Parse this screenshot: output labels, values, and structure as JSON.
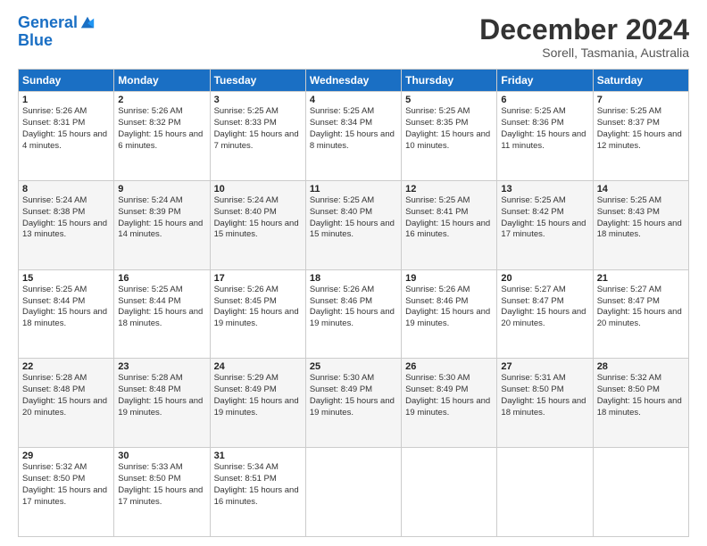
{
  "header": {
    "logo_line1": "General",
    "logo_line2": "Blue",
    "month_title": "December 2024",
    "location": "Sorell, Tasmania, Australia"
  },
  "weekdays": [
    "Sunday",
    "Monday",
    "Tuesday",
    "Wednesday",
    "Thursday",
    "Friday",
    "Saturday"
  ],
  "weeks": [
    [
      {
        "day": "1",
        "sunrise": "Sunrise: 5:26 AM",
        "sunset": "Sunset: 8:31 PM",
        "daylight": "Daylight: 15 hours and 4 minutes."
      },
      {
        "day": "2",
        "sunrise": "Sunrise: 5:26 AM",
        "sunset": "Sunset: 8:32 PM",
        "daylight": "Daylight: 15 hours and 6 minutes."
      },
      {
        "day": "3",
        "sunrise": "Sunrise: 5:25 AM",
        "sunset": "Sunset: 8:33 PM",
        "daylight": "Daylight: 15 hours and 7 minutes."
      },
      {
        "day": "4",
        "sunrise": "Sunrise: 5:25 AM",
        "sunset": "Sunset: 8:34 PM",
        "daylight": "Daylight: 15 hours and 8 minutes."
      },
      {
        "day": "5",
        "sunrise": "Sunrise: 5:25 AM",
        "sunset": "Sunset: 8:35 PM",
        "daylight": "Daylight: 15 hours and 10 minutes."
      },
      {
        "day": "6",
        "sunrise": "Sunrise: 5:25 AM",
        "sunset": "Sunset: 8:36 PM",
        "daylight": "Daylight: 15 hours and 11 minutes."
      },
      {
        "day": "7",
        "sunrise": "Sunrise: 5:25 AM",
        "sunset": "Sunset: 8:37 PM",
        "daylight": "Daylight: 15 hours and 12 minutes."
      }
    ],
    [
      {
        "day": "8",
        "sunrise": "Sunrise: 5:24 AM",
        "sunset": "Sunset: 8:38 PM",
        "daylight": "Daylight: 15 hours and 13 minutes."
      },
      {
        "day": "9",
        "sunrise": "Sunrise: 5:24 AM",
        "sunset": "Sunset: 8:39 PM",
        "daylight": "Daylight: 15 hours and 14 minutes."
      },
      {
        "day": "10",
        "sunrise": "Sunrise: 5:24 AM",
        "sunset": "Sunset: 8:40 PM",
        "daylight": "Daylight: 15 hours and 15 minutes."
      },
      {
        "day": "11",
        "sunrise": "Sunrise: 5:25 AM",
        "sunset": "Sunset: 8:40 PM",
        "daylight": "Daylight: 15 hours and 15 minutes."
      },
      {
        "day": "12",
        "sunrise": "Sunrise: 5:25 AM",
        "sunset": "Sunset: 8:41 PM",
        "daylight": "Daylight: 15 hours and 16 minutes."
      },
      {
        "day": "13",
        "sunrise": "Sunrise: 5:25 AM",
        "sunset": "Sunset: 8:42 PM",
        "daylight": "Daylight: 15 hours and 17 minutes."
      },
      {
        "day": "14",
        "sunrise": "Sunrise: 5:25 AM",
        "sunset": "Sunset: 8:43 PM",
        "daylight": "Daylight: 15 hours and 18 minutes."
      }
    ],
    [
      {
        "day": "15",
        "sunrise": "Sunrise: 5:25 AM",
        "sunset": "Sunset: 8:44 PM",
        "daylight": "Daylight: 15 hours and 18 minutes."
      },
      {
        "day": "16",
        "sunrise": "Sunrise: 5:25 AM",
        "sunset": "Sunset: 8:44 PM",
        "daylight": "Daylight: 15 hours and 18 minutes."
      },
      {
        "day": "17",
        "sunrise": "Sunrise: 5:26 AM",
        "sunset": "Sunset: 8:45 PM",
        "daylight": "Daylight: 15 hours and 19 minutes."
      },
      {
        "day": "18",
        "sunrise": "Sunrise: 5:26 AM",
        "sunset": "Sunset: 8:46 PM",
        "daylight": "Daylight: 15 hours and 19 minutes."
      },
      {
        "day": "19",
        "sunrise": "Sunrise: 5:26 AM",
        "sunset": "Sunset: 8:46 PM",
        "daylight": "Daylight: 15 hours and 19 minutes."
      },
      {
        "day": "20",
        "sunrise": "Sunrise: 5:27 AM",
        "sunset": "Sunset: 8:47 PM",
        "daylight": "Daylight: 15 hours and 20 minutes."
      },
      {
        "day": "21",
        "sunrise": "Sunrise: 5:27 AM",
        "sunset": "Sunset: 8:47 PM",
        "daylight": "Daylight: 15 hours and 20 minutes."
      }
    ],
    [
      {
        "day": "22",
        "sunrise": "Sunrise: 5:28 AM",
        "sunset": "Sunset: 8:48 PM",
        "daylight": "Daylight: 15 hours and 20 minutes."
      },
      {
        "day": "23",
        "sunrise": "Sunrise: 5:28 AM",
        "sunset": "Sunset: 8:48 PM",
        "daylight": "Daylight: 15 hours and 19 minutes."
      },
      {
        "day": "24",
        "sunrise": "Sunrise: 5:29 AM",
        "sunset": "Sunset: 8:49 PM",
        "daylight": "Daylight: 15 hours and 19 minutes."
      },
      {
        "day": "25",
        "sunrise": "Sunrise: 5:30 AM",
        "sunset": "Sunset: 8:49 PM",
        "daylight": "Daylight: 15 hours and 19 minutes."
      },
      {
        "day": "26",
        "sunrise": "Sunrise: 5:30 AM",
        "sunset": "Sunset: 8:49 PM",
        "daylight": "Daylight: 15 hours and 19 minutes."
      },
      {
        "day": "27",
        "sunrise": "Sunrise: 5:31 AM",
        "sunset": "Sunset: 8:50 PM",
        "daylight": "Daylight: 15 hours and 18 minutes."
      },
      {
        "day": "28",
        "sunrise": "Sunrise: 5:32 AM",
        "sunset": "Sunset: 8:50 PM",
        "daylight": "Daylight: 15 hours and 18 minutes."
      }
    ],
    [
      {
        "day": "29",
        "sunrise": "Sunrise: 5:32 AM",
        "sunset": "Sunset: 8:50 PM",
        "daylight": "Daylight: 15 hours and 17 minutes."
      },
      {
        "day": "30",
        "sunrise": "Sunrise: 5:33 AM",
        "sunset": "Sunset: 8:50 PM",
        "daylight": "Daylight: 15 hours and 17 minutes."
      },
      {
        "day": "31",
        "sunrise": "Sunrise: 5:34 AM",
        "sunset": "Sunset: 8:51 PM",
        "daylight": "Daylight: 15 hours and 16 minutes."
      },
      null,
      null,
      null,
      null
    ]
  ]
}
